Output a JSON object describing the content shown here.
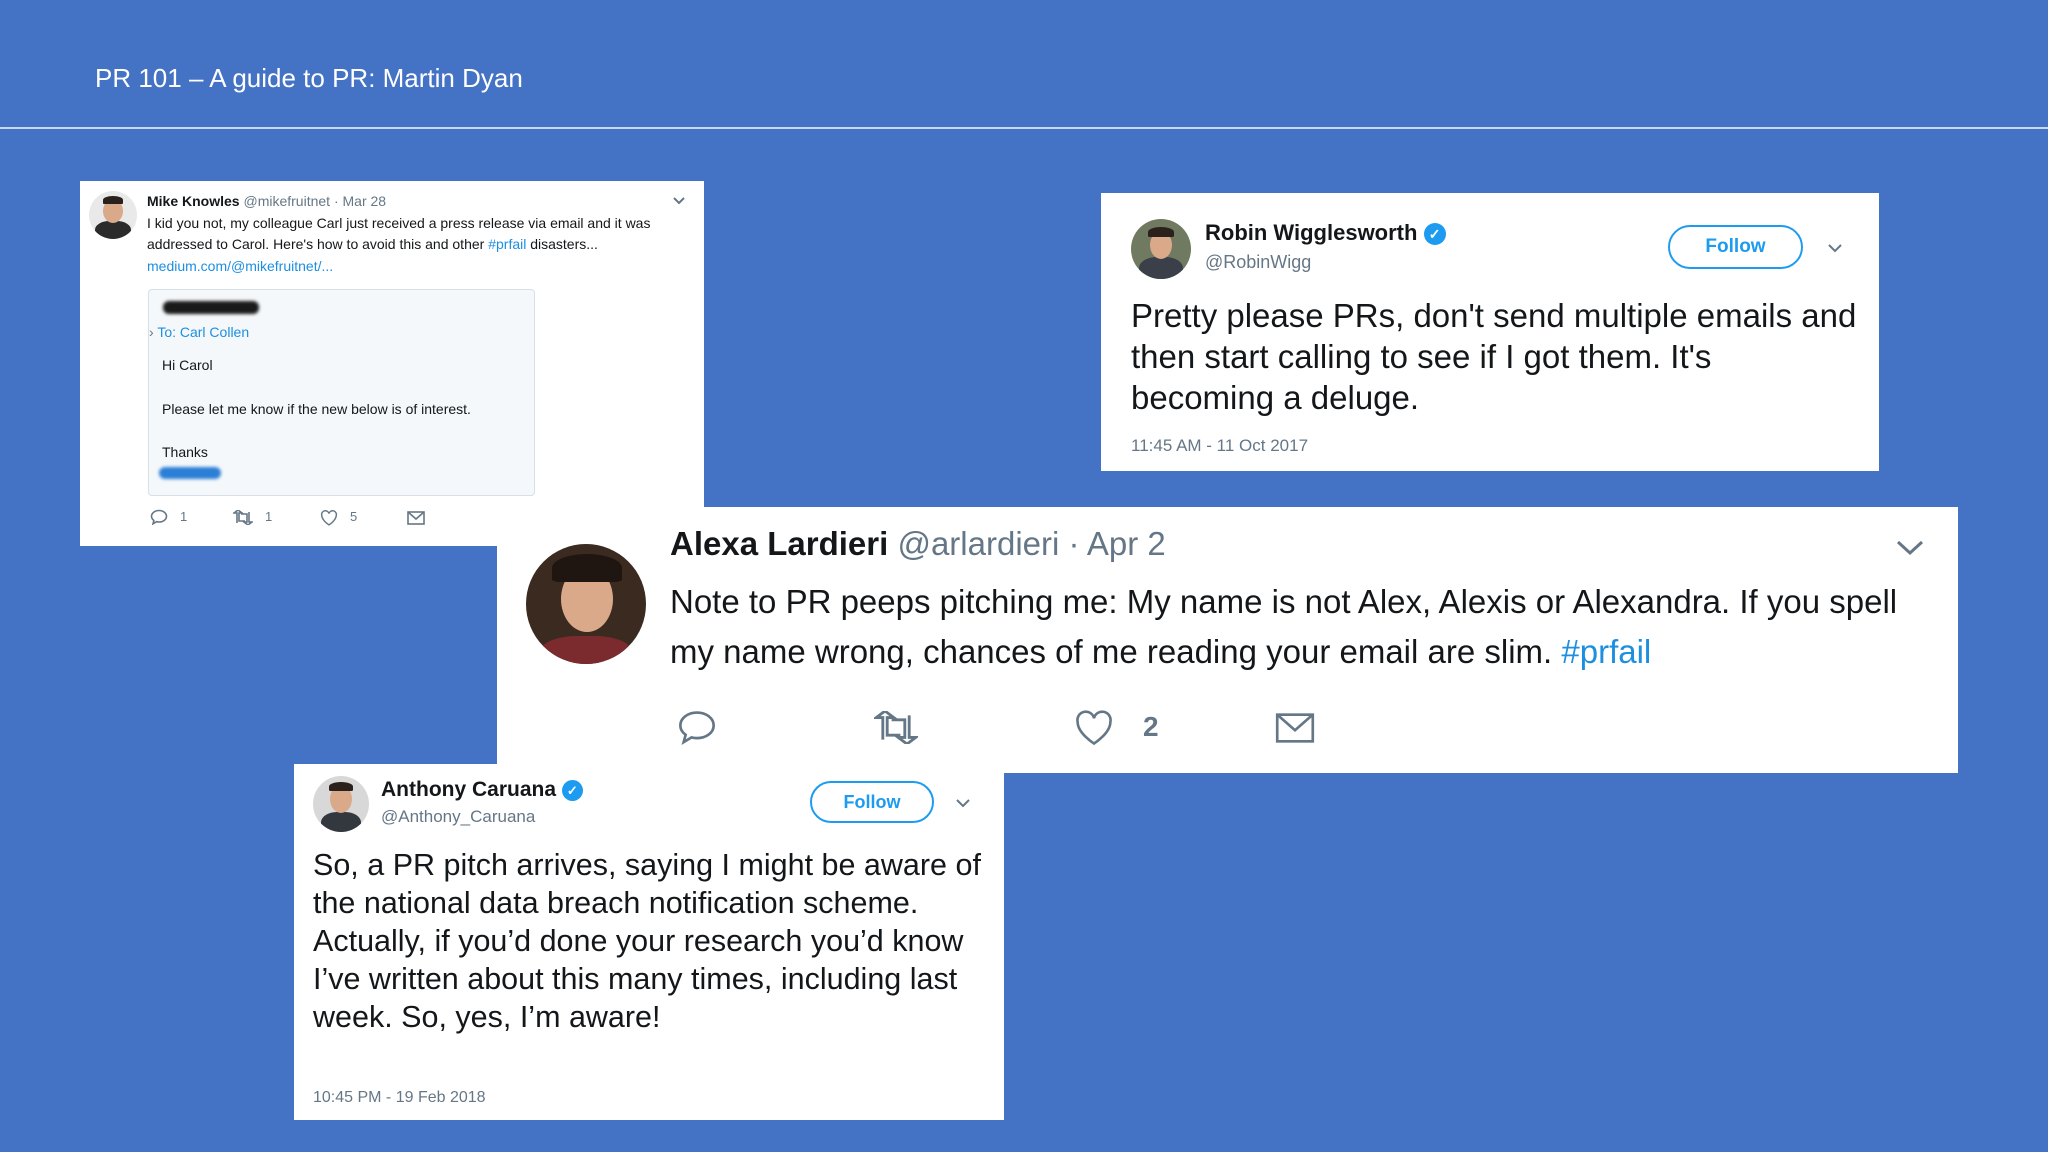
{
  "slide": {
    "title": "PR 101 – A guide to PR: Martin Dyan"
  },
  "tweet1": {
    "name": "Mike Knowles",
    "handle": "@mikefruitnet",
    "date": "· Mar 28",
    "text_part1": "I kid you not, my colleague Carl just received a press release via email and it was addressed to Carol. Here's how to avoid this and other ",
    "hashtag": "#prfail",
    "text_part2": " disasters...",
    "link": "medium.com/@mikefruitnet/...",
    "preview": {
      "to": "To: Carl Collen",
      "greeting": "Hi Carol",
      "body": "Please let me know if the new below is of interest.",
      "signoff": "Thanks"
    },
    "replies": "1",
    "retweets": "1",
    "likes": "5"
  },
  "tweet2": {
    "name": "Robin Wigglesworth",
    "handle": "@RobinWigg",
    "follow_label": "Follow",
    "text": "Pretty please PRs, don't send multiple emails and then start calling to see if I got them. It's becoming a deluge.",
    "timestamp": "11:45 AM - 11 Oct 2017"
  },
  "tweet3": {
    "name": "Alexa Lardieri",
    "handle": "@arlardieri",
    "date": "· Apr 2",
    "text": "Note to PR peeps pitching me: My name is not Alex, Alexis or Alexandra. If you spell my name wrong, chances of me reading your email are slim. ",
    "hashtag": "#prfail",
    "likes": "2"
  },
  "tweet4": {
    "name": "Anthony Caruana",
    "handle": "@Anthony_Caruana",
    "follow_label": "Follow",
    "text": "So, a PR pitch arrives, saying I might be aware of the national data breach notification scheme. Actually, if you’d done your research you’d know I’ve written about this many times, including last week. So, yes, I’m aware!",
    "timestamp": "10:45 PM - 19 Feb 2018"
  },
  "icons": {
    "verified": "verified-badge-icon",
    "reply": "reply-icon",
    "retweet": "retweet-icon",
    "like": "heart-icon",
    "message": "envelope-icon",
    "menu": "chevron-down-icon"
  },
  "colors": {
    "background": "#4472c4",
    "twitter_blue": "#1d9bf0",
    "text": "#14171a",
    "muted": "#657786"
  }
}
